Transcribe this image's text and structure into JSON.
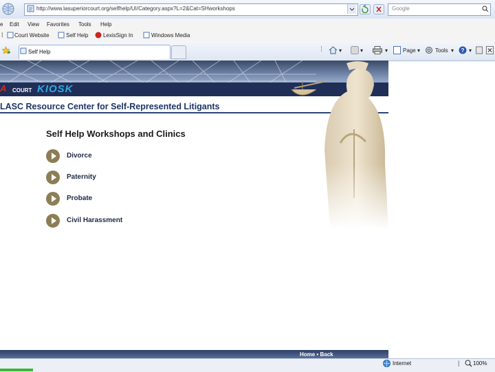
{
  "browser": {
    "address": "http://www.lasuperiorcourt.org/selfhelp/UI/Category.aspx?L=2&Cat=SHworkshops",
    "search_placeholder": "Google",
    "menu": [
      "e",
      "Edit",
      "View",
      "Favorites",
      "Tools",
      "Help"
    ],
    "links": [
      "Court Website",
      "Self Help",
      "LexisSign In",
      "Windows Media"
    ],
    "tab_title": "Self Help",
    "toolbar": {
      "page_label": "Page",
      "tools_label": "Tools"
    }
  },
  "page": {
    "logo": {
      "a": "A",
      "court": "COURT",
      "kiosk": "KIOSK"
    },
    "subtitle": "LASC Resource Center for Self-Represented Litigants",
    "heading": "Self Help Workshops and Clinics",
    "workshops": [
      "Divorce",
      "Paternity",
      "Probate",
      "Civil Harassment"
    ],
    "footer_text": "Home • Back"
  },
  "status": {
    "zone": "Internet",
    "zoom": "100%"
  },
  "colors": {
    "banner_dark": "#1f2f57",
    "title_blue": "#1c3566",
    "bullet": "#8d7d55"
  }
}
